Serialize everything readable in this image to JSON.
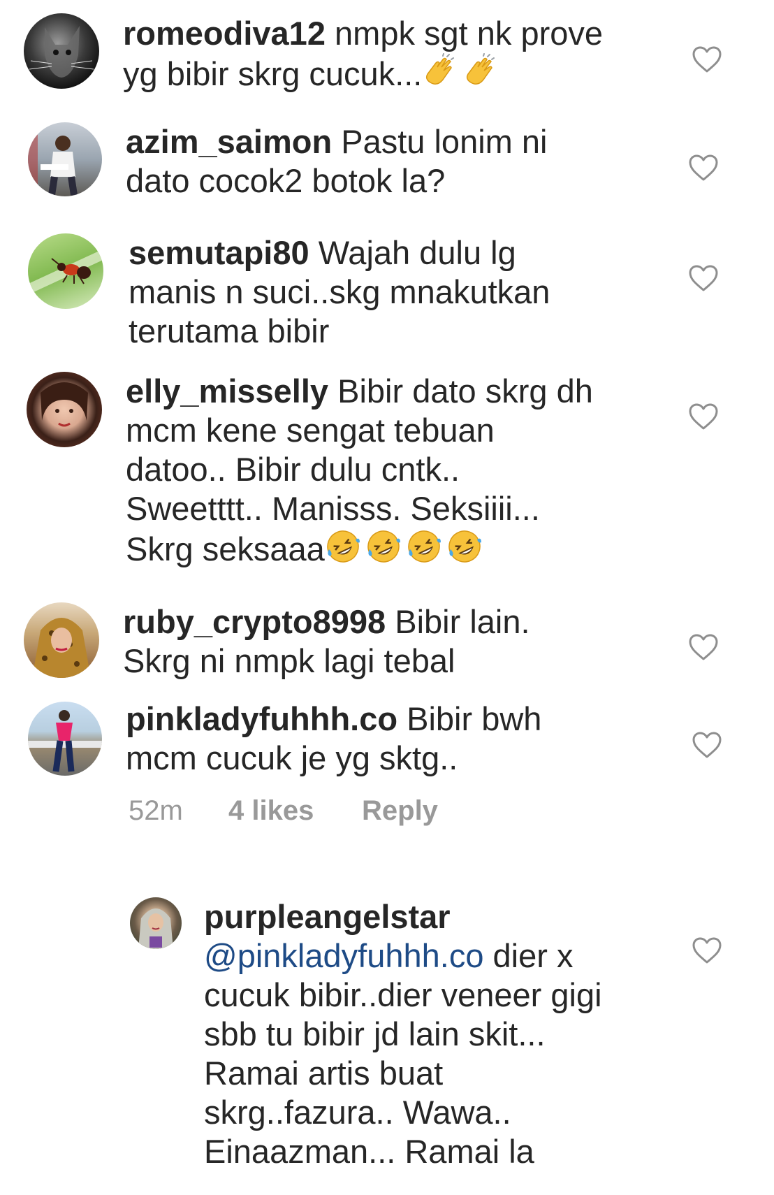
{
  "comments": [
    {
      "username": "romeodiva12",
      "text_line1": "nmpk sgt nk prove",
      "text_line2": "yg bibir skrg cucuk...",
      "emoji": [
        "clapping-hands",
        "clapping-hands"
      ]
    },
    {
      "username": "azim_saimon",
      "text_line1": "Pastu lonim ni",
      "text_line2": "dato cocok2 botok la?"
    },
    {
      "username": "semutapi80",
      "text_line1": "Wajah dulu lg",
      "text_line2": "manis n suci..skg mnakutkan",
      "text_line3": "terutama bibir"
    },
    {
      "username": "elly_misselly",
      "text_line1": "Bibir dato skrg dh",
      "text_line2": "mcm kene sengat tebuan",
      "text_line3": "datoo.. Bibir dulu cntk..",
      "text_line4": "Sweetttt.. Manisss. Seksiiii...",
      "text_line5": "Skrg seksaaa",
      "emoji": [
        "rolling-laughing",
        "rolling-laughing",
        "rolling-laughing",
        "rolling-laughing"
      ]
    },
    {
      "username": "ruby_crypto8998",
      "text_line1": "Bibir lain.",
      "text_line2": "Skrg ni nmpk lagi tebal"
    },
    {
      "username": "pinkladyfuhhh.co",
      "text_line1": "Bibir bwh",
      "text_line2": "mcm cucuk je yg sktg.."
    }
  ],
  "meta": {
    "time": "52m",
    "likes": "4 likes",
    "reply": "Reply"
  },
  "reply_comment": {
    "username": "purpleangelstar",
    "mention": "@pinkladyfuhhh.co",
    "text_line1_rest": " dier x",
    "text_line2": "cucuk bibir..dier veneer gigi",
    "text_line3": "sbb tu bibir jd lain skit...",
    "text_line4": "Ramai artis buat",
    "text_line5": "skrg..fazura.. Wawa..",
    "text_line6": "Einaazman... Ramai la"
  },
  "colors": {
    "text": "#262626",
    "meta": "#999999",
    "mention": "#1e4b86",
    "heart_stroke": "#8e8e8e"
  }
}
